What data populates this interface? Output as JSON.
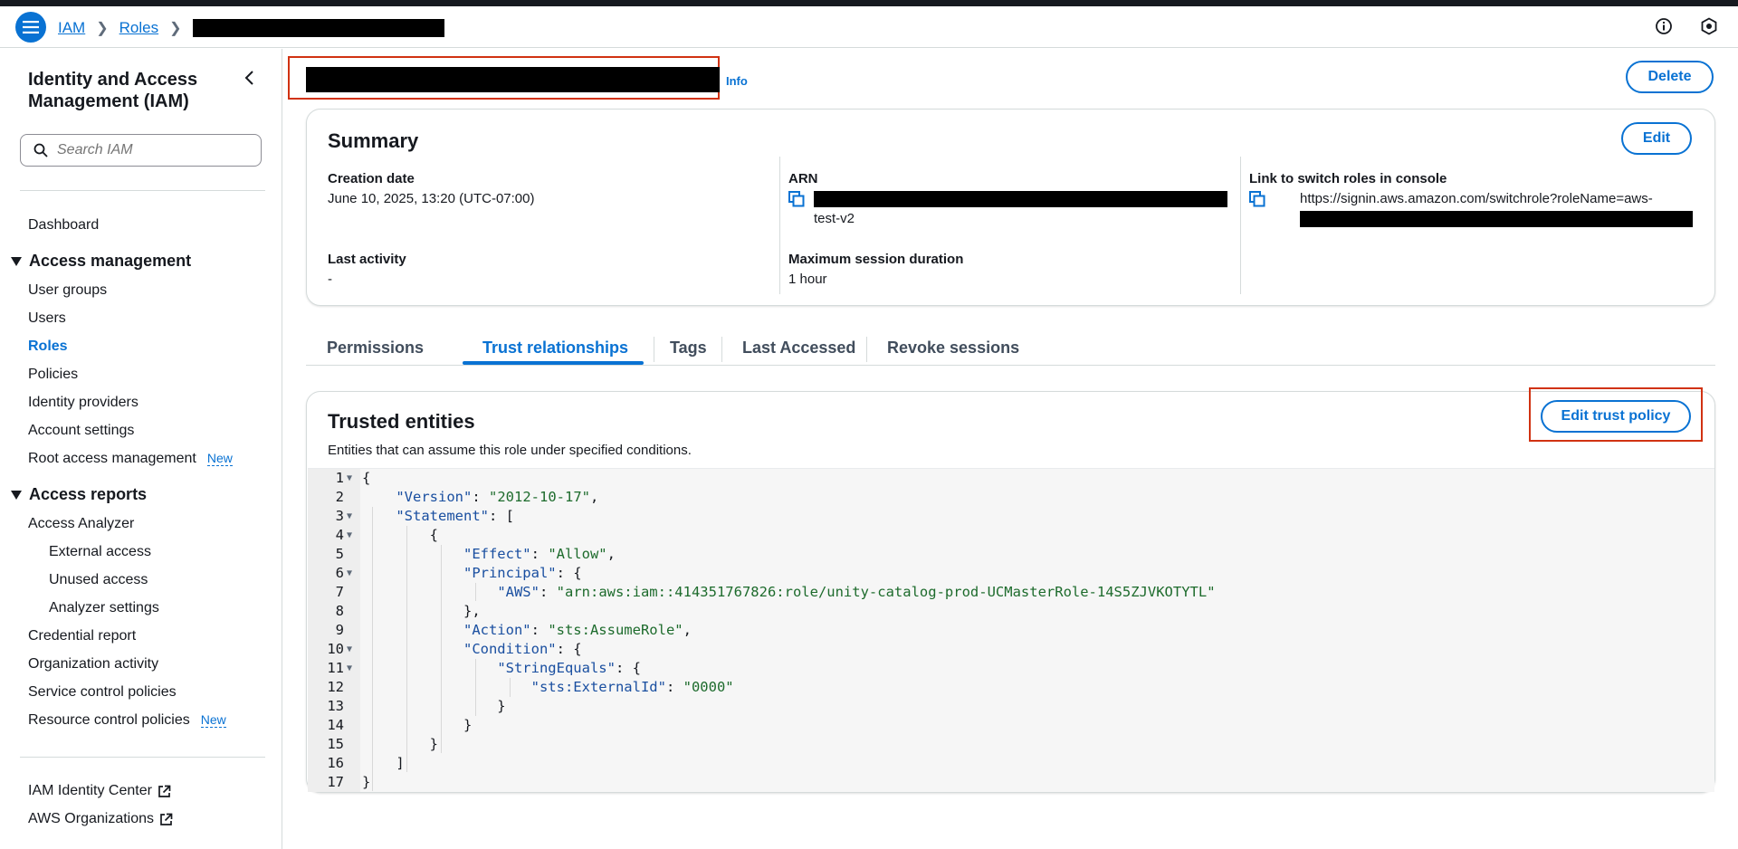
{
  "breadcrumb": {
    "iam": "IAM",
    "roles": "Roles"
  },
  "sidebar": {
    "title": "Identity and Access Management (IAM)",
    "search_placeholder": "Search IAM",
    "dashboard": "Dashboard",
    "access_management": {
      "heading": "Access management",
      "items": [
        "User groups",
        "Users",
        "Roles",
        "Policies",
        "Identity providers",
        "Account settings",
        "Root access management"
      ],
      "new_badge": "New"
    },
    "access_reports": {
      "heading": "Access reports",
      "access_analyzer": "Access Analyzer",
      "analyzer_items": [
        "External access",
        "Unused access",
        "Analyzer settings"
      ],
      "items": [
        "Credential report",
        "Organization activity",
        "Service control policies",
        "Resource control policies"
      ],
      "new_badge": "New"
    },
    "footer_links": [
      "IAM Identity Center",
      "AWS Organizations"
    ]
  },
  "header": {
    "info": "Info",
    "delete_label": "Delete"
  },
  "summary": {
    "title": "Summary",
    "edit_label": "Edit",
    "creation_date_label": "Creation date",
    "creation_date": "June 10, 2025, 13:20 (UTC-07:00)",
    "last_activity_label": "Last activity",
    "last_activity": "-",
    "arn_label": "ARN",
    "arn_suffix": "test-v2",
    "max_session_label": "Maximum session duration",
    "max_session": "1 hour",
    "switch_link_label": "Link to switch roles in console",
    "switch_link": "https://signin.aws.amazon.com/switchrole?roleName=aws-"
  },
  "tabs": [
    "Permissions",
    "Trust relationships",
    "Tags",
    "Last Accessed",
    "Revoke sessions"
  ],
  "trusted": {
    "title": "Trusted entities",
    "description": "Entities that can assume this role under specified conditions.",
    "edit_label": "Edit trust policy",
    "policy": {
      "version_key": "\"Version\"",
      "version_val": "\"2012-10-17\"",
      "statement_key": "\"Statement\"",
      "effect_key": "\"Effect\"",
      "effect_val": "\"Allow\"",
      "principal_key": "\"Principal\"",
      "aws_key": "\"AWS\"",
      "aws_val": "\"arn:aws:iam::414351767826:role/unity-catalog-prod-UCMasterRole-14S5ZJVKOTYTL\"",
      "action_key": "\"Action\"",
      "action_val": "\"sts:AssumeRole\"",
      "condition_key": "\"Condition\"",
      "stringequals_key": "\"StringEquals\"",
      "externalid_key": "\"sts:ExternalId\"",
      "externalid_val": "\"0000\""
    },
    "line_numbers": [
      "1",
      "2",
      "3",
      "4",
      "5",
      "6",
      "7",
      "8",
      "9",
      "10",
      "11",
      "12",
      "13",
      "14",
      "15",
      "16",
      "17"
    ]
  },
  "colors": {
    "accent": "#0972d3",
    "highlight_box": "#d13212"
  }
}
